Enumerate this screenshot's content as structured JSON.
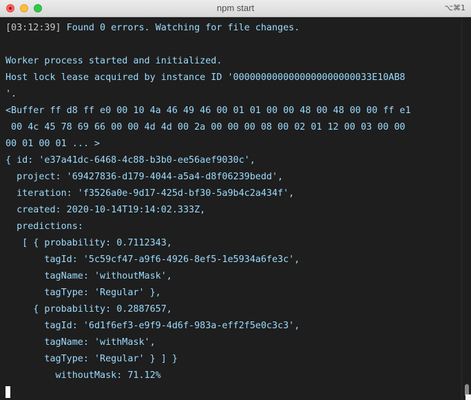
{
  "window": {
    "title": "npm start",
    "shortcut": "⌥⌘1"
  },
  "terminal": {
    "timestamp": "[03:12:39]",
    "lines": [
      " Found 0 errors. Watching for file changes.",
      "",
      "Worker process started and initialized.",
      "Host lock lease acquired by instance ID '0000000000000000000000033E10AB8",
      "'.",
      "<Buffer ff d8 ff e0 00 10 4a 46 49 46 00 01 01 00 00 48 00 48 00 00 ff e1",
      " 00 4c 45 78 69 66 00 00 4d 4d 00 2a 00 00 00 08 00 02 01 12 00 03 00 00",
      "00 01 00 01 ... >",
      "{ id: 'e37a41dc-6468-4c88-b3b0-ee56aef9030c',",
      "  project: '69427836-d179-4044-a5a4-d8f06239bedd',",
      "  iteration: 'f3526a0e-9d17-425d-bf30-5a9b4c2a434f',",
      "  created: 2020-10-14T19:14:02.333Z,",
      "  predictions:",
      "   [ { probability: 0.7112343,",
      "       tagId: '5c59cf47-a9f6-4926-8ef5-1e5934a6fe3c',",
      "       tagName: 'withoutMask',",
      "       tagType: 'Regular' },",
      "     { probability: 0.2887657,",
      "       tagId: '6d1f6ef3-e9f9-4d6f-983a-eff2f5e0c3c3',",
      "       tagName: 'withMask',",
      "       tagType: 'Regular' } ] }",
      "         withoutMask: 71.12%"
    ]
  }
}
